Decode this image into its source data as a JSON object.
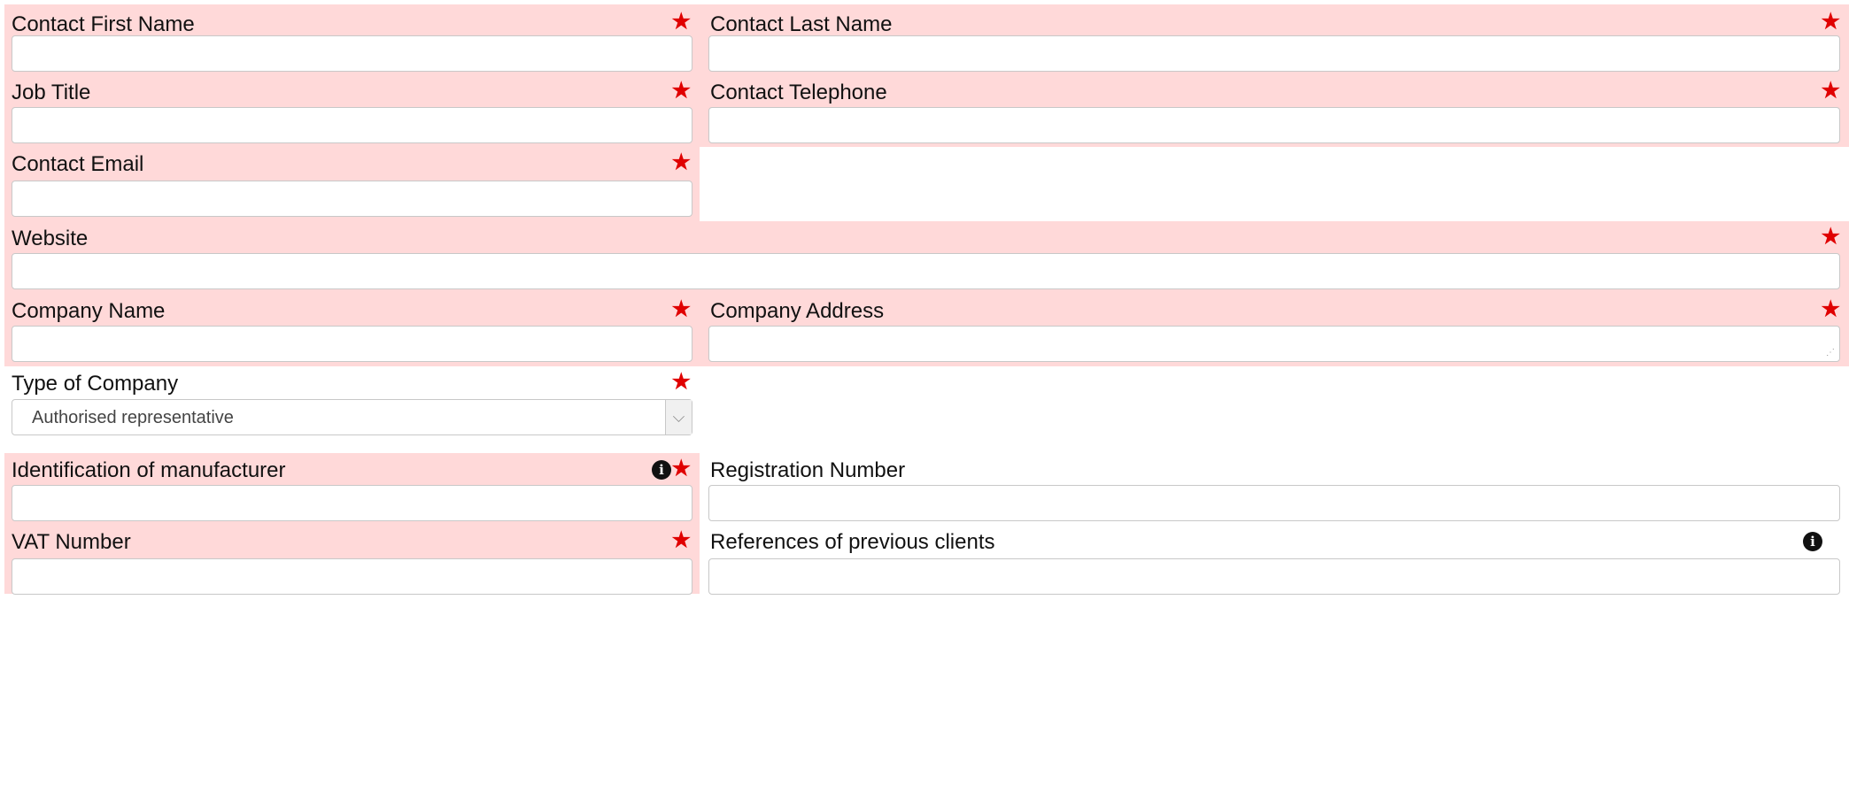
{
  "fields": {
    "contact_first_name": {
      "label": "Contact First Name",
      "value": "",
      "required": "★"
    },
    "contact_last_name": {
      "label": "Contact Last Name",
      "value": "",
      "required": "★"
    },
    "job_title": {
      "label": "Job Title",
      "value": "",
      "required": "★"
    },
    "contact_telephone": {
      "label": "Contact Telephone",
      "value": "",
      "required": "★"
    },
    "contact_email": {
      "label": "Contact Email",
      "value": "",
      "required": "★"
    },
    "website": {
      "label": "Website",
      "value": "",
      "required": "★"
    },
    "company_name": {
      "label": "Company Name",
      "value": "",
      "required": "★"
    },
    "company_address": {
      "label": "Company Address",
      "value": "",
      "required": "★"
    },
    "type_of_company": {
      "label": "Type of Company",
      "selected": "Authorised representative",
      "required": "★"
    },
    "identification_of_manufacturer": {
      "label": "Identification of manufacturer",
      "value": "",
      "required": "★",
      "info_icon": "i"
    },
    "registration_number": {
      "label": "Registration Number",
      "value": ""
    },
    "vat_number": {
      "label": "VAT Number",
      "value": "",
      "required": "★"
    },
    "references_of_previous_clients": {
      "label": "References of previous clients",
      "value": "",
      "info_icon": "i"
    }
  },
  "colors": {
    "error_background": "#ffd9d9",
    "required_star": "#e00000"
  },
  "icons": {
    "dropdown": "chevron-down-icon",
    "info": "info-icon",
    "resize": "resize-grip-icon"
  }
}
